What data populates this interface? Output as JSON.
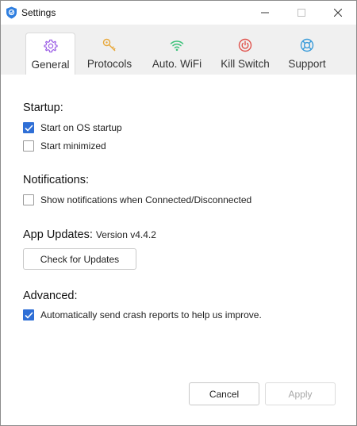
{
  "window": {
    "title": "Settings"
  },
  "tabs": [
    {
      "label": "General",
      "icon": "gear-icon",
      "color": "#9b5de5",
      "active": true
    },
    {
      "label": "Protocols",
      "icon": "key-icon",
      "color": "#e8a83a",
      "active": false
    },
    {
      "label": "Auto. WiFi",
      "icon": "wifi-icon",
      "color": "#3cc27a",
      "active": false
    },
    {
      "label": "Kill Switch",
      "icon": "power-icon",
      "color": "#e0524c",
      "active": false
    },
    {
      "label": "Support",
      "icon": "lifebuoy-icon",
      "color": "#3a9bd9",
      "active": false
    }
  ],
  "startup": {
    "heading": "Startup:",
    "start_on_boot": {
      "label": "Start on OS startup",
      "checked": true
    },
    "start_minimized": {
      "label": "Start minimized",
      "checked": false
    }
  },
  "notifications": {
    "heading": "Notifications:",
    "show_notifications": {
      "label": "Show notifications when Connected/Disconnected",
      "checked": false
    }
  },
  "app_updates": {
    "heading": "App Updates:",
    "version": "Version v4.4.2",
    "check_button": "Check for Updates"
  },
  "advanced": {
    "heading": "Advanced:",
    "crash_reports": {
      "label": "Automatically send crash reports to help us improve.",
      "checked": true
    }
  },
  "footer": {
    "cancel": "Cancel",
    "apply": "Apply"
  },
  "colors": {
    "accent": "#2f6fd6",
    "tab_strip": "#f0f0f0",
    "disabled_text": "#a8a8a8"
  }
}
